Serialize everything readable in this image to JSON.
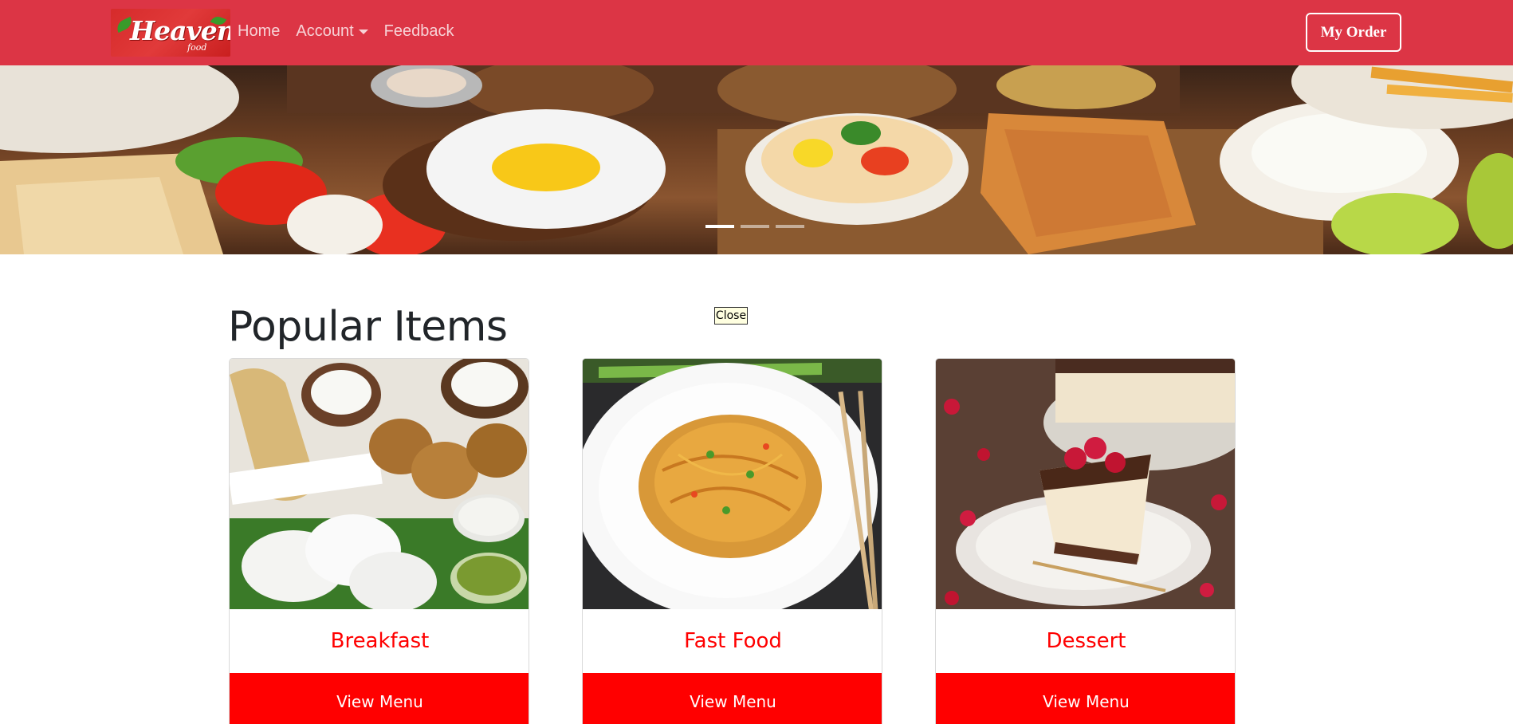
{
  "navbar": {
    "logo_text": "Heavens",
    "logo_sub": "food",
    "links": [
      {
        "label": "Home"
      },
      {
        "label": "Account"
      },
      {
        "label": "Feedback"
      }
    ],
    "order_button": "My Order",
    "background_color": "#dc3545"
  },
  "carousel": {
    "slide_count": 3,
    "active_slide": 1
  },
  "popup": {
    "close_label": "Close"
  },
  "main": {
    "section_title": "Popular Items",
    "cards": [
      {
        "title": "Breakfast",
        "button": "View Menu",
        "image": "idli-dosa-vada-photo"
      },
      {
        "title": "Fast Food",
        "button": "View Menu",
        "image": "noodles-photo"
      },
      {
        "title": "Dessert",
        "button": "View Menu",
        "image": "cheesecake-photo"
      }
    ],
    "accent_color": "#ff0000"
  }
}
